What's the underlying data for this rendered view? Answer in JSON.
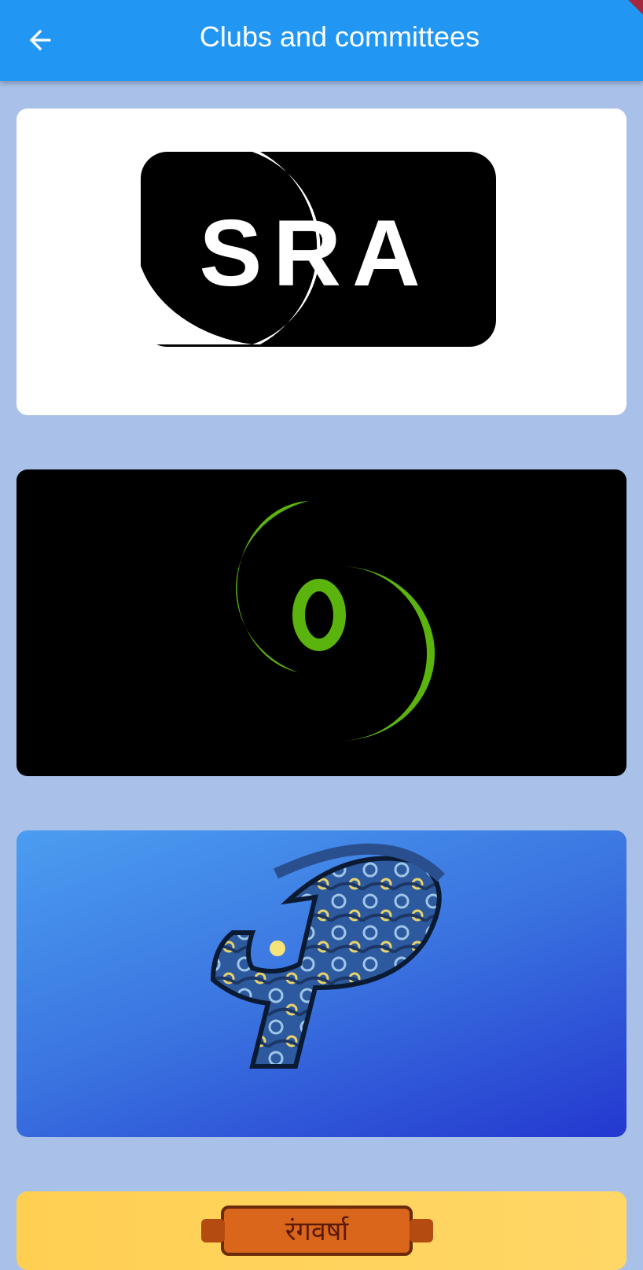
{
  "appbar": {
    "title": "Clubs and committees",
    "back_icon": "arrow-left-icon",
    "background_color": "#2196f3"
  },
  "clubs": [
    {
      "logo_icon": "sra-logo",
      "logo_text": "SRA",
      "background_color": "#ffffff"
    },
    {
      "logo_icon": "green-crescents-logo",
      "background_color": "#000000"
    },
    {
      "logo_icon": "starry-night-p-logo",
      "background_color": "#3a73e0"
    },
    {
      "logo_icon": "rangavarsha-scroll-logo",
      "logo_text": "रंगवर्षा",
      "background_color": "#ffd15c"
    }
  ]
}
